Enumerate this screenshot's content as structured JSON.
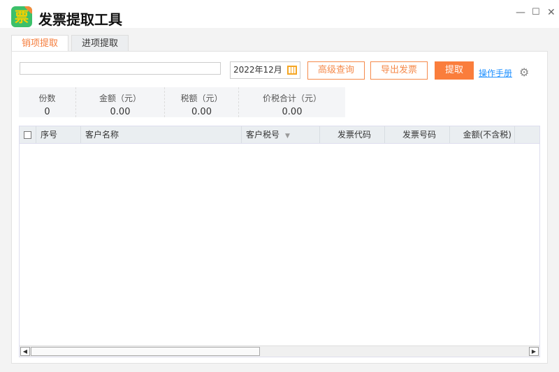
{
  "app": {
    "title": "发票提取工具",
    "logo_glyph": "票"
  },
  "tabs": [
    {
      "label": "销项提取"
    },
    {
      "label": "进项提取"
    }
  ],
  "toolbar": {
    "search_value": "",
    "date": "2022年12月",
    "advanced": "高级查询",
    "export": "导出发票",
    "extract": "提取",
    "manual": "操作手册"
  },
  "stats": [
    {
      "label": "份数",
      "value": "0"
    },
    {
      "label": "金额（元）",
      "value": "0.00"
    },
    {
      "label": "税额（元）",
      "value": "0.00"
    },
    {
      "label": "价税合计（元）",
      "value": "0.00"
    }
  ],
  "table": {
    "columns": [
      "序号",
      "客户名称",
      "客户税号",
      "发票代码",
      "发票号码",
      "金额(不含税)"
    ]
  },
  "colors": {
    "accent": "#fa7d3c",
    "link": "#1e90ff"
  }
}
